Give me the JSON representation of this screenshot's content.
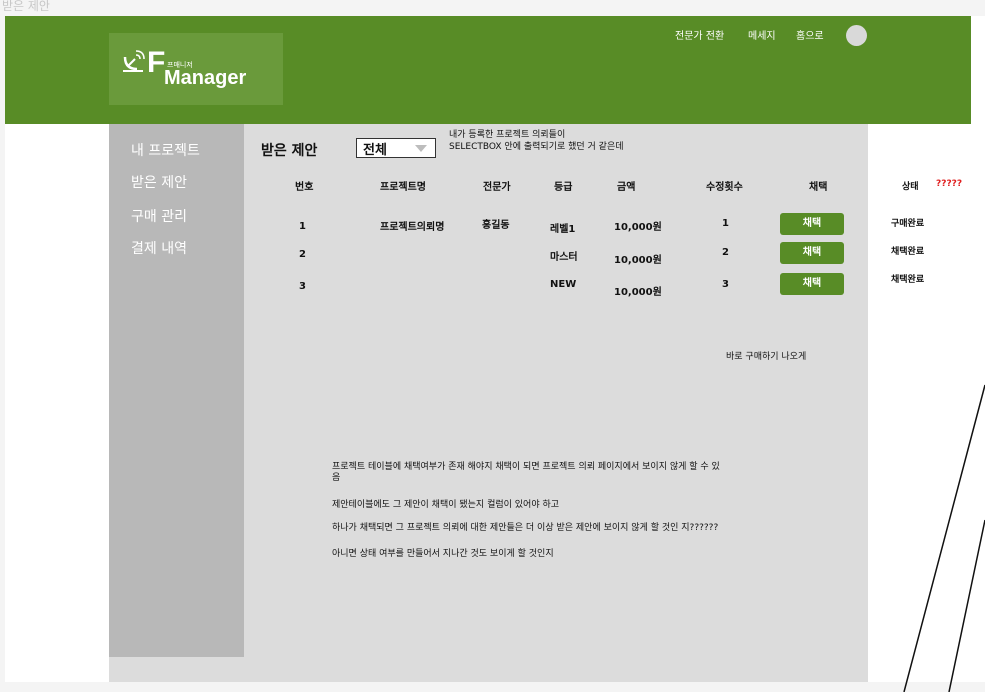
{
  "frame_label": "받은 제안",
  "logo": {
    "small": "프매니저",
    "f": "F",
    "manager": "Manager"
  },
  "nav": {
    "items": [
      "전문가 전환",
      "메세지",
      "홈으로"
    ]
  },
  "sidebar": {
    "items": [
      "내 프로젝트",
      "받은 제안",
      "구매 관리",
      "결제 내역"
    ]
  },
  "page_title": "받은 제안",
  "filter": {
    "value": "전체"
  },
  "notes": {
    "selectbox_line1": "내가 등록한 프로젝트 의뢰들이",
    "selectbox_line2": "SELECTBOX 안에 출력되기로 했던 거 같은데",
    "buy_now": "바로 구매하기 나오게",
    "body": [
      "프로젝트 테이블에 채택여부가 존재 해야지 채택이 되면 프로젝트 의뢰 페이지에서 보이지 않게 할 수 있음",
      "제안테이블에도 그 제안이 채택이 됐는지 컬럼이 있어야 하고",
      "하나가 채택되면 그 프로젝트 의뢰에 대한 제안들은 더 이상 받은 제안에 보이지 않게 할 것인 지??????",
      "아니면 상태 여부를 만들어서 지나간 것도 보이게 할 것인지"
    ]
  },
  "table": {
    "headers": [
      "번호",
      "프로젝트명",
      "전문가",
      "등급",
      "금액",
      "수정횟수",
      "채택"
    ],
    "rows": [
      {
        "no": "1",
        "project": "프로젝트의뢰명",
        "expert": "홍길동",
        "grade": "레벨1",
        "amount": "10,000원",
        "revisions": "1",
        "action": "채택"
      },
      {
        "no": "2",
        "project": "",
        "expert": "",
        "grade": "마스터",
        "amount": "10,000원",
        "revisions": "2",
        "action": "채택"
      },
      {
        "no": "3",
        "project": "",
        "expert": "",
        "grade": "NEW",
        "amount": "10,000원",
        "revisions": "3",
        "action": "채택"
      }
    ]
  },
  "status": {
    "header": "상태",
    "question": "?????",
    "question_color": "#e02020",
    "values": [
      "구매완료",
      "채택완료",
      "채택완료"
    ]
  },
  "colors": {
    "header_green": "#588c26",
    "sidebar_gray": "#b8b8b8",
    "content_gray": "#dcdcdc"
  }
}
